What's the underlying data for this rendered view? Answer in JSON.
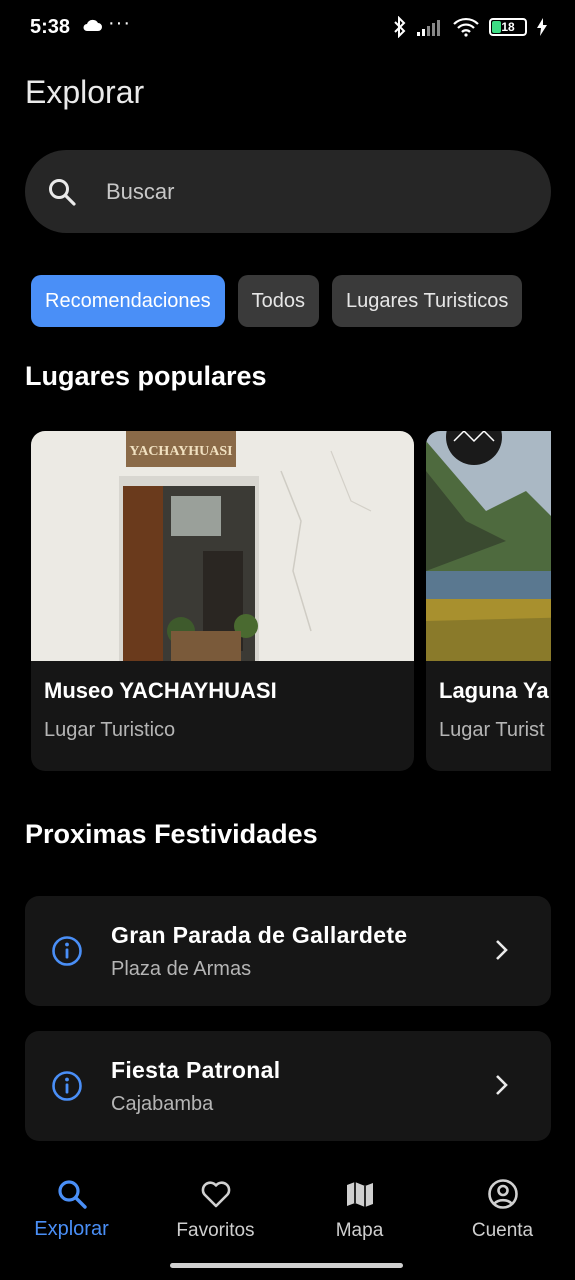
{
  "status_bar": {
    "time": "5:38",
    "overflow_dots": "···",
    "battery_level": "18"
  },
  "header": {
    "title": "Explorar"
  },
  "search": {
    "placeholder": "Buscar"
  },
  "filters": {
    "chips": [
      "Recomendaciones",
      "Todos",
      "Lugares Turisticos"
    ],
    "selected": "Recomendaciones"
  },
  "popular": {
    "title": "Lugares populares",
    "items": [
      {
        "title": "Museo YACHAYHUASI",
        "subtitle": "Lugar Turistico",
        "sign_text": "YACHAYHUASI"
      },
      {
        "title": "Laguna Ya",
        "subtitle": "Lugar Turist"
      }
    ]
  },
  "festivities": {
    "title": "Proximas Festividades",
    "items": [
      {
        "title": "Gran Parada de Gallardete",
        "subtitle": "Plaza de Armas"
      },
      {
        "title": "Fiesta Patronal",
        "subtitle": "Cajabamba"
      }
    ]
  },
  "bottom_nav": {
    "items": [
      {
        "label": "Explorar",
        "icon": "search-icon",
        "active": true
      },
      {
        "label": "Favoritos",
        "icon": "heart-icon",
        "active": false
      },
      {
        "label": "Mapa",
        "icon": "map-icon",
        "active": false
      },
      {
        "label": "Cuenta",
        "icon": "account-icon",
        "active": false
      }
    ]
  },
  "colors": {
    "accent": "#4a8ff7",
    "background": "#000000",
    "surface": "#161616",
    "chip": "#3a3a3a"
  }
}
